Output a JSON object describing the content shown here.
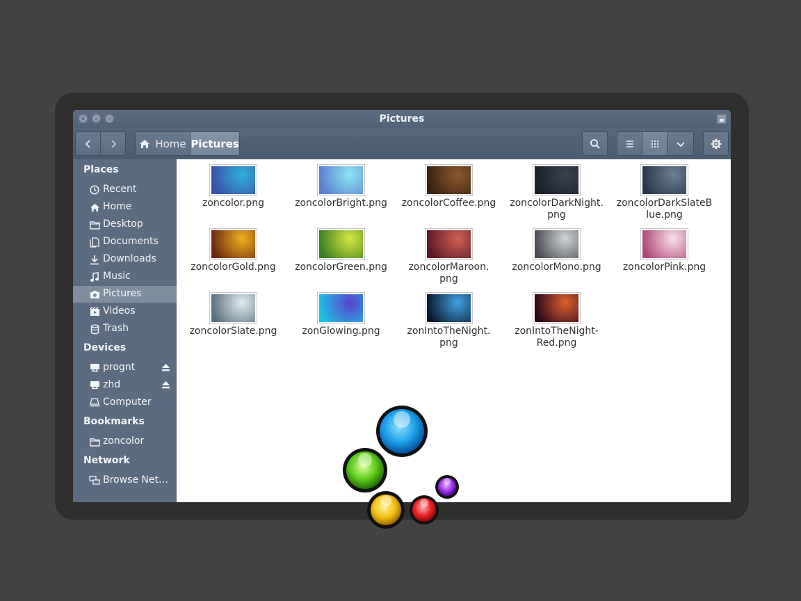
{
  "window": {
    "title": "Pictures"
  },
  "breadcrumb": {
    "home": "Home",
    "current": "Pictures"
  },
  "sidebar": {
    "places_heading": "Places",
    "places": [
      {
        "label": "Recent",
        "icon": "clock-icon"
      },
      {
        "label": "Home",
        "icon": "home-icon"
      },
      {
        "label": "Desktop",
        "icon": "folder-icon"
      },
      {
        "label": "Documents",
        "icon": "documents-icon"
      },
      {
        "label": "Downloads",
        "icon": "download-icon"
      },
      {
        "label": "Music",
        "icon": "music-icon"
      },
      {
        "label": "Pictures",
        "icon": "camera-icon",
        "selected": true
      },
      {
        "label": "Videos",
        "icon": "video-icon"
      },
      {
        "label": "Trash",
        "icon": "trash-icon"
      }
    ],
    "devices_heading": "Devices",
    "devices": [
      {
        "label": "progn​t",
        "icon": "drive-icon",
        "eject": true
      },
      {
        "label": "zhd",
        "icon": "drive-icon",
        "eject": true
      },
      {
        "label": "Computer",
        "icon": "computer-icon"
      }
    ],
    "bookmarks_heading": "Bookmarks",
    "bookmarks": [
      {
        "label": "zoncolor",
        "icon": "folder-icon"
      }
    ],
    "network_heading": "Network",
    "network": [
      {
        "label": "Browse Net…",
        "icon": "network-icon"
      }
    ]
  },
  "files": [
    {
      "name": "zoncolor.png",
      "colors": [
        "#2fb0d8",
        "#3a4fa8"
      ]
    },
    {
      "name": "zoncolorBright.png",
      "colors": [
        "#8fe6f0",
        "#5a7fd0"
      ]
    },
    {
      "name": "zoncolorCoffee.png",
      "colors": [
        "#8a5a2a",
        "#3a2210"
      ]
    },
    {
      "name": "zoncolorDarkNight.png",
      "colors": [
        "#3a4452",
        "#1a1f28"
      ]
    },
    {
      "name": "zoncolorDarkSlateBlue.png",
      "colors": [
        "#6a7f96",
        "#2a3648"
      ]
    },
    {
      "name": "zoncolorGold.png",
      "colors": [
        "#f0b020",
        "#6a2810"
      ]
    },
    {
      "name": "zoncolorGreen.png",
      "colors": [
        "#d8e840",
        "#3a8020"
      ]
    },
    {
      "name": "zoncolorMaroon.png",
      "colors": [
        "#d06050",
        "#5a1828"
      ]
    },
    {
      "name": "zoncolorMono.png",
      "colors": [
        "#d0d4d8",
        "#4a4e54"
      ]
    },
    {
      "name": "zoncolorPink.png",
      "colors": [
        "#f8e0ec",
        "#b04878"
      ]
    },
    {
      "name": "zoncolorSlate.png",
      "colors": [
        "#e0ecef",
        "#5a7080"
      ]
    },
    {
      "name": "zonGlowing.png",
      "colors": [
        "#5a40d0",
        "#20c0e0"
      ]
    },
    {
      "name": "zonIntoTheNight.png",
      "colors": [
        "#40a0e0",
        "#0a1830"
      ]
    },
    {
      "name": "zonIntoTheNight-Red.png",
      "colors": [
        "#e06030",
        "#280818"
      ]
    }
  ],
  "file_labels": [
    [
      "zoncolor.png"
    ],
    [
      "zoncolorBright.png"
    ],
    [
      "zoncolorCoffee.png"
    ],
    [
      "zoncolorDarkNight.",
      "png"
    ],
    [
      "zoncolorDarkSlateB",
      "lue.png"
    ],
    [
      "zoncolorGold.png"
    ],
    [
      "zoncolorGreen.png"
    ],
    [
      "zoncolorMaroon.",
      "png"
    ],
    [
      "zoncolorMono.png"
    ],
    [
      "zoncolorPink.png"
    ],
    [
      "zoncolorSlate.png"
    ],
    [
      "zonGlowing.png"
    ],
    [
      "zonIntoTheNight.",
      "png"
    ],
    [
      "zonIntoTheNight-",
      "Red.png"
    ]
  ],
  "icons": {
    "back": "chevron-left-icon",
    "forward": "chevron-right-icon",
    "search": "search-icon",
    "list_view": "list-view-icon",
    "grid_view": "grid-view-icon",
    "view_menu": "chevron-down-icon",
    "settings": "gear-icon"
  },
  "colors": {
    "titlebar": "#56677c",
    "sidebar": "#5c6c80",
    "sidebar_selected": "#7f8e9f",
    "background": "#434343"
  }
}
